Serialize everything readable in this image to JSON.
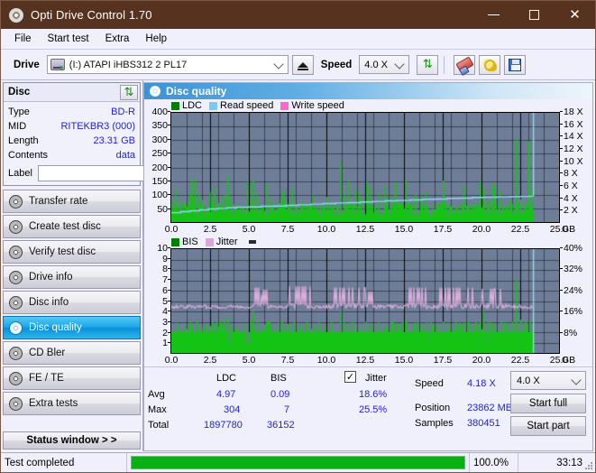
{
  "window": {
    "title": "Opti Drive Control 1.70",
    "app_icon": "disc-icon",
    "minimize_label": "",
    "maximize_label": "",
    "close_label": "✕"
  },
  "menu": [
    {
      "label": "File"
    },
    {
      "label": "Start test"
    },
    {
      "label": "Extra"
    },
    {
      "label": "Help"
    }
  ],
  "toolbar": {
    "drive_label": "Drive",
    "drive_value": "(I:)  ATAPI iHBS312  2 PL17",
    "eject_icon": "eject-icon",
    "speed_label": "Speed",
    "speed_value": "4.0 X",
    "refresh_icon": "refresh-icon",
    "erase_icon": "eraser-icon",
    "tools_icon": "gears-icon",
    "save_icon": "save-icon"
  },
  "disc_panel": {
    "title": "Disc",
    "refresh_icon": "refresh-icon",
    "rows": [
      {
        "key": "Type",
        "value": "BD-R"
      },
      {
        "key": "MID",
        "value": "RITEKBR3 (000)"
      },
      {
        "key": "Length",
        "value": "23.31 GB"
      },
      {
        "key": "Contents",
        "value": "data"
      }
    ],
    "label_key": "Label",
    "label_value": "",
    "label_placeholder": "",
    "disc_button_icon": "cd-icon"
  },
  "nav": {
    "items": [
      {
        "label": "Transfer rate",
        "icon": "disc-icon",
        "active": false
      },
      {
        "label": "Create test disc",
        "icon": "disc-icon",
        "active": false
      },
      {
        "label": "Verify test disc",
        "icon": "disc-icon",
        "active": false
      },
      {
        "label": "Drive info",
        "icon": "disc-icon",
        "active": false
      },
      {
        "label": "Disc info",
        "icon": "disc-icon",
        "active": false
      },
      {
        "label": "Disc quality",
        "icon": "disc-icon",
        "active": true
      },
      {
        "label": "CD Bler",
        "icon": "disc-icon",
        "active": false
      },
      {
        "label": "FE / TE",
        "icon": "disc-icon",
        "active": false
      },
      {
        "label": "Extra tests",
        "icon": "disc-icon",
        "active": false
      }
    ],
    "status_window_label": "Status window > >"
  },
  "content": {
    "header_title": "Disc quality",
    "header_icon": "disc-quality-icon"
  },
  "chart_data": [
    {
      "id": "ldc-chart",
      "type": "line",
      "title": "",
      "xlabel": "GB",
      "ylabel": "",
      "y2label": "X",
      "xlim": [
        0,
        25
      ],
      "ylim": [
        0,
        400
      ],
      "y2lim": [
        0,
        18
      ],
      "xticks": [
        "0.0",
        "2.5",
        "5.0",
        "7.5",
        "10.0",
        "12.5",
        "15.0",
        "17.5",
        "20.0",
        "22.5",
        "25.0"
      ],
      "xtick_unit": "GB",
      "yticks": [
        50,
        100,
        150,
        200,
        250,
        300,
        350,
        400
      ],
      "y2ticks": [
        "2 X",
        "4 X",
        "6 X",
        "8 X",
        "10 X",
        "12 X",
        "14 X",
        "16 X",
        "18 X"
      ],
      "grid": true,
      "plot_bg": "#6e7e98",
      "legend_position": "top-left",
      "legend": [
        {
          "name": "LDC",
          "color": "#008000"
        },
        {
          "name": "Read speed",
          "color": "#7ec8f0"
        },
        {
          "name": "Write speed",
          "color": "#ff66cc"
        }
      ],
      "series": [
        {
          "name": "LDC",
          "color": "#14c414",
          "render": "vertical-bars",
          "data_end_gb": 23.35,
          "baseline": 18,
          "avg": 4.97,
          "max": 304,
          "spikes": [
            [
              0.35,
              40
            ],
            [
              0.6,
              55
            ],
            [
              0.9,
              48
            ],
            [
              1.25,
              152
            ],
            [
              1.5,
              60
            ],
            [
              1.9,
              70
            ],
            [
              2.2,
              55
            ],
            [
              2.45,
              110
            ],
            [
              2.6,
              92
            ],
            [
              2.75,
              130
            ],
            [
              3.0,
              70
            ],
            [
              3.2,
              58
            ],
            [
              3.45,
              100
            ],
            [
              3.6,
              168
            ],
            [
              3.85,
              62
            ],
            [
              4.2,
              48
            ],
            [
              4.6,
              55
            ],
            [
              5.05,
              78
            ],
            [
              5.25,
              152
            ],
            [
              5.45,
              98
            ],
            [
              5.8,
              60
            ],
            [
              6.1,
              142
            ],
            [
              6.5,
              55
            ],
            [
              6.9,
              62
            ],
            [
              7.2,
              115
            ],
            [
              7.6,
              58
            ],
            [
              8.0,
              66
            ],
            [
              8.4,
              72
            ],
            [
              8.8,
              60
            ],
            [
              9.2,
              58
            ],
            [
              9.6,
              62
            ],
            [
              10.0,
              70
            ],
            [
              10.4,
              58
            ],
            [
              10.9,
              218
            ],
            [
              11.3,
              60
            ],
            [
              11.7,
              64
            ],
            [
              12.1,
              58
            ],
            [
              12.55,
              148
            ],
            [
              12.9,
              60
            ],
            [
              13.3,
              66
            ],
            [
              13.7,
              58
            ],
            [
              14.1,
              62
            ],
            [
              14.4,
              146
            ],
            [
              14.7,
              70
            ],
            [
              15.05,
              156
            ],
            [
              15.4,
              62
            ],
            [
              15.7,
              100
            ],
            [
              16.05,
              92
            ],
            [
              16.4,
              58
            ],
            [
              16.8,
              66
            ],
            [
              17.2,
              60
            ],
            [
              17.5,
              152
            ],
            [
              17.9,
              64
            ],
            [
              18.3,
              58
            ],
            [
              18.7,
              70
            ],
            [
              19.1,
              62
            ],
            [
              19.5,
              58
            ],
            [
              19.9,
              148
            ],
            [
              20.1,
              120
            ],
            [
              20.35,
              60
            ],
            [
              20.7,
              140
            ],
            [
              21.1,
              62
            ],
            [
              21.5,
              58
            ],
            [
              21.9,
              66
            ],
            [
              22.2,
              305
            ],
            [
              22.5,
              84
            ],
            [
              22.8,
              62
            ],
            [
              23.0,
              296
            ],
            [
              23.2,
              120
            ]
          ]
        },
        {
          "name": "Read speed",
          "color": "#8fd8f8",
          "render": "step-line",
          "axis": "y2",
          "points": [
            [
              0.0,
              1.55
            ],
            [
              0.6,
              1.7
            ],
            [
              1.2,
              1.85
            ],
            [
              1.8,
              2.0
            ],
            [
              2.4,
              2.15
            ],
            [
              3.0,
              2.25
            ],
            [
              3.6,
              2.35
            ],
            [
              4.2,
              2.45
            ],
            [
              5.0,
              2.5
            ],
            [
              5.8,
              2.6
            ],
            [
              6.6,
              2.65
            ],
            [
              7.4,
              2.75
            ],
            [
              8.2,
              2.85
            ],
            [
              9.0,
              2.95
            ],
            [
              9.8,
              3.05
            ],
            [
              10.6,
              3.15
            ],
            [
              11.4,
              3.2
            ],
            [
              12.2,
              3.3
            ],
            [
              13.0,
              3.4
            ],
            [
              13.8,
              3.5
            ],
            [
              14.6,
              3.55
            ],
            [
              15.4,
              3.65
            ],
            [
              16.2,
              3.75
            ],
            [
              17.0,
              3.8
            ],
            [
              17.8,
              3.9
            ],
            [
              18.6,
              3.95
            ],
            [
              19.4,
              4.05
            ],
            [
              20.2,
              4.1
            ],
            [
              21.0,
              4.15
            ],
            [
              21.8,
              4.2
            ],
            [
              22.6,
              4.25
            ],
            [
              23.3,
              4.3
            ]
          ],
          "spike_at_end": {
            "x": 23.35,
            "to": 18.0
          }
        }
      ]
    },
    {
      "id": "bis-jitter-chart",
      "type": "line",
      "title": "",
      "xlabel": "GB",
      "ylabel": "",
      "y2label": "%",
      "xlim": [
        0,
        25
      ],
      "ylim": [
        0,
        10
      ],
      "y2lim": [
        0,
        40
      ],
      "xticks": [
        "0.0",
        "2.5",
        "5.0",
        "7.5",
        "10.0",
        "12.5",
        "15.0",
        "17.5",
        "20.0",
        "22.5",
        "25.0"
      ],
      "xtick_unit": "GB",
      "yticks": [
        1,
        2,
        3,
        4,
        5,
        6,
        7,
        8,
        9,
        10
      ],
      "y2ticks": [
        "8%",
        "16%",
        "24%",
        "32%",
        "40%"
      ],
      "grid": true,
      "plot_bg": "#6e7e98",
      "legend_position": "top-left",
      "legend": [
        {
          "name": "BIS",
          "color": "#008000"
        },
        {
          "name": "Jitter",
          "color": "#d8a8d8"
        }
      ],
      "series": [
        {
          "name": "BIS",
          "color": "#14c414",
          "render": "vertical-bars",
          "data_end_gb": 23.35,
          "baseline": 2.0,
          "avg": 0.09,
          "max": 7,
          "spikes": [
            [
              0.4,
              2.6
            ],
            [
              0.8,
              2.4
            ],
            [
              1.15,
              3.0
            ],
            [
              1.3,
              2.8
            ],
            [
              1.6,
              3.0
            ],
            [
              1.9,
              2.5
            ],
            [
              2.2,
              2.7
            ],
            [
              2.6,
              3.0
            ],
            [
              2.9,
              3.0
            ],
            [
              3.1,
              3.2
            ],
            [
              3.35,
              3.0
            ],
            [
              3.6,
              3.5
            ],
            [
              3.9,
              2.6
            ],
            [
              4.2,
              2.5
            ],
            [
              4.6,
              2.8
            ],
            [
              5.05,
              3.0
            ],
            [
              5.25,
              4.0
            ],
            [
              5.5,
              3.0
            ],
            [
              5.9,
              2.6
            ],
            [
              6.3,
              3.0
            ],
            [
              6.7,
              2.6
            ],
            [
              7.1,
              3.0
            ],
            [
              7.5,
              2.8
            ],
            [
              7.9,
              3.0
            ],
            [
              8.3,
              2.6
            ],
            [
              8.7,
              3.0
            ],
            [
              9.1,
              2.7
            ],
            [
              9.5,
              3.0
            ],
            [
              9.9,
              2.6
            ],
            [
              10.3,
              3.0
            ],
            [
              10.9,
              4.0
            ],
            [
              11.3,
              2.8
            ],
            [
              11.7,
              3.0
            ],
            [
              12.1,
              2.6
            ],
            [
              12.5,
              3.0
            ],
            [
              12.9,
              2.8
            ],
            [
              13.3,
              3.0
            ],
            [
              13.7,
              2.6
            ],
            [
              14.1,
              3.0
            ],
            [
              14.5,
              2.8
            ],
            [
              14.9,
              3.0
            ],
            [
              15.1,
              3.0
            ],
            [
              15.5,
              2.8
            ],
            [
              15.9,
              3.0
            ],
            [
              16.3,
              2.7
            ],
            [
              16.7,
              3.0
            ],
            [
              17.1,
              2.8
            ],
            [
              17.5,
              3.0
            ],
            [
              17.9,
              2.7
            ],
            [
              18.3,
              3.0
            ],
            [
              18.7,
              2.8
            ],
            [
              19.1,
              3.0
            ],
            [
              19.5,
              2.7
            ],
            [
              19.9,
              3.0
            ],
            [
              20.05,
              4.0
            ],
            [
              20.4,
              3.0
            ],
            [
              20.8,
              2.8
            ],
            [
              21.2,
              3.0
            ],
            [
              21.6,
              2.8
            ],
            [
              22.0,
              3.0
            ],
            [
              22.2,
              7.0
            ],
            [
              22.5,
              3.2
            ],
            [
              22.8,
              3.0
            ],
            [
              23.1,
              3.2
            ]
          ]
        },
        {
          "name": "Jitter",
          "color": "#dcaedc",
          "render": "noisy-line",
          "base": 4.45,
          "noise": 0.18,
          "avg_pct": "18.6%",
          "max_pct": "25.5%",
          "bursts": [
            [
              5.3,
              6.0,
              6.3
            ],
            [
              5.6,
              6.1,
              5.6
            ],
            [
              5.9,
              6.2,
              6.1
            ],
            [
              7.4,
              9.0,
              6.4
            ],
            [
              10.4,
              12.5,
              6.3
            ],
            [
              12.6,
              13.0,
              5.9
            ],
            [
              14.9,
              16.4,
              6.3
            ],
            [
              17.3,
              19.5,
              6.3
            ],
            [
              20.0,
              21.6,
              6.2
            ]
          ]
        },
        {
          "name": "Read speed marker",
          "color": "#8fd8f8",
          "render": "end-spike",
          "x": 23.35
        }
      ]
    }
  ],
  "stats": {
    "headers": {
      "ldc": "LDC",
      "bis": "BIS",
      "jitter": "Jitter"
    },
    "jitter_checked": true,
    "jitter_check_glyph": "✓",
    "rows": [
      {
        "key": "Avg",
        "ldc": "4.97",
        "bis": "0.09",
        "jitter": "18.6%"
      },
      {
        "key": "Max",
        "ldc": "304",
        "bis": "7",
        "jitter": "25.5%"
      },
      {
        "key": "Total",
        "ldc": "1897780",
        "bis": "36152",
        "jitter": ""
      }
    ],
    "speed_key": "Speed",
    "speed_value": "4.18 X",
    "position_key": "Position",
    "position_value": "23862 MB",
    "samples_key": "Samples",
    "samples_value": "380451",
    "speed_select_value": "4.0 X",
    "start_full_label": "Start full",
    "start_part_label": "Start part"
  },
  "statusbar": {
    "status_text": "Test completed",
    "progress_percent": "100.0%",
    "progress_value": 100,
    "elapsed": "33:13",
    "progress_color": "#09b014"
  }
}
